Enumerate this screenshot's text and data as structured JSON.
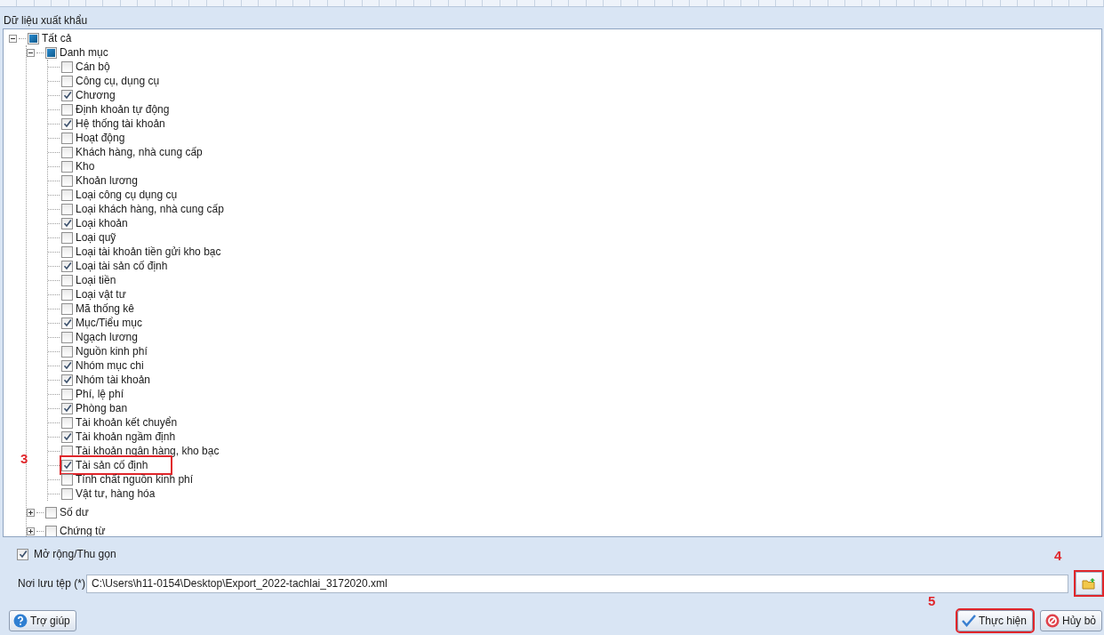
{
  "panel_title": "Dữ liệu xuất khẩu",
  "tree": [
    {
      "label": "Tất cả",
      "expanded": true,
      "checked": false,
      "partial": true,
      "children": [
        {
          "label": "Danh mục",
          "expanded": true,
          "checked": false,
          "partial": true,
          "children": [
            {
              "label": "Cán bộ",
              "checked": false
            },
            {
              "label": "Công cụ, dụng cụ",
              "checked": false
            },
            {
              "label": "Chương",
              "checked": true
            },
            {
              "label": "Định khoản tự động",
              "checked": false
            },
            {
              "label": "Hệ thống tài khoản",
              "checked": true
            },
            {
              "label": "Hoạt động",
              "checked": false
            },
            {
              "label": "Khách hàng, nhà cung cấp",
              "checked": false
            },
            {
              "label": "Kho",
              "checked": false
            },
            {
              "label": "Khoản lương",
              "checked": false
            },
            {
              "label": "Loại công cụ dụng cụ",
              "checked": false
            },
            {
              "label": "Loại khách hàng, nhà cung cấp",
              "checked": false
            },
            {
              "label": "Loại khoản",
              "checked": true
            },
            {
              "label": "Loại quỹ",
              "checked": false
            },
            {
              "label": "Loại tài khoản tiền gửi kho bạc",
              "checked": false
            },
            {
              "label": "Loại tài sản cố định",
              "checked": true
            },
            {
              "label": "Loại tiền",
              "checked": false
            },
            {
              "label": "Loại vật tư",
              "checked": false
            },
            {
              "label": "Mã thống kê",
              "checked": false
            },
            {
              "label": "Mục/Tiểu mục",
              "checked": true
            },
            {
              "label": "Ngạch lương",
              "checked": false
            },
            {
              "label": "Nguồn kinh phí",
              "checked": false
            },
            {
              "label": "Nhóm mục chi",
              "checked": true
            },
            {
              "label": "Nhóm tài khoản",
              "checked": true
            },
            {
              "label": "Phí, lệ phí",
              "checked": false
            },
            {
              "label": "Phòng ban",
              "checked": true
            },
            {
              "label": "Tài khoản kết chuyển",
              "checked": false
            },
            {
              "label": "Tài khoản ngầm định",
              "checked": true
            },
            {
              "label": "Tài khoản ngân hàng, kho bạc",
              "checked": false
            },
            {
              "label": "Tài sản cố định",
              "checked": true,
              "annotation": "3"
            },
            {
              "label": "Tính chất nguồn kinh phí",
              "checked": false
            },
            {
              "label": "Vật tư, hàng hóa",
              "checked": false
            }
          ]
        },
        {
          "label": "Số dư",
          "kind": "group",
          "expanded": false,
          "checked": false,
          "partial": false
        },
        {
          "label": "Chứng từ",
          "kind": "group",
          "expanded": false,
          "checked": false,
          "partial": false
        }
      ]
    }
  ],
  "expand_toggle": {
    "label": "Mở rộng/Thu gọn",
    "checked": true
  },
  "file_path": {
    "label": "Nơi lưu tệp (*)",
    "value": "C:\\Users\\h11-0154\\Desktop\\Export_2022-tachlai_3172020.xml",
    "browse_annotation": "4"
  },
  "buttons": [
    {
      "kind": "help",
      "label": "Trợ giúp"
    },
    {
      "kind": "run",
      "label": "Thực hiện",
      "annotation": "5"
    },
    {
      "kind": "cancel",
      "label": "Hủy bỏ"
    }
  ]
}
